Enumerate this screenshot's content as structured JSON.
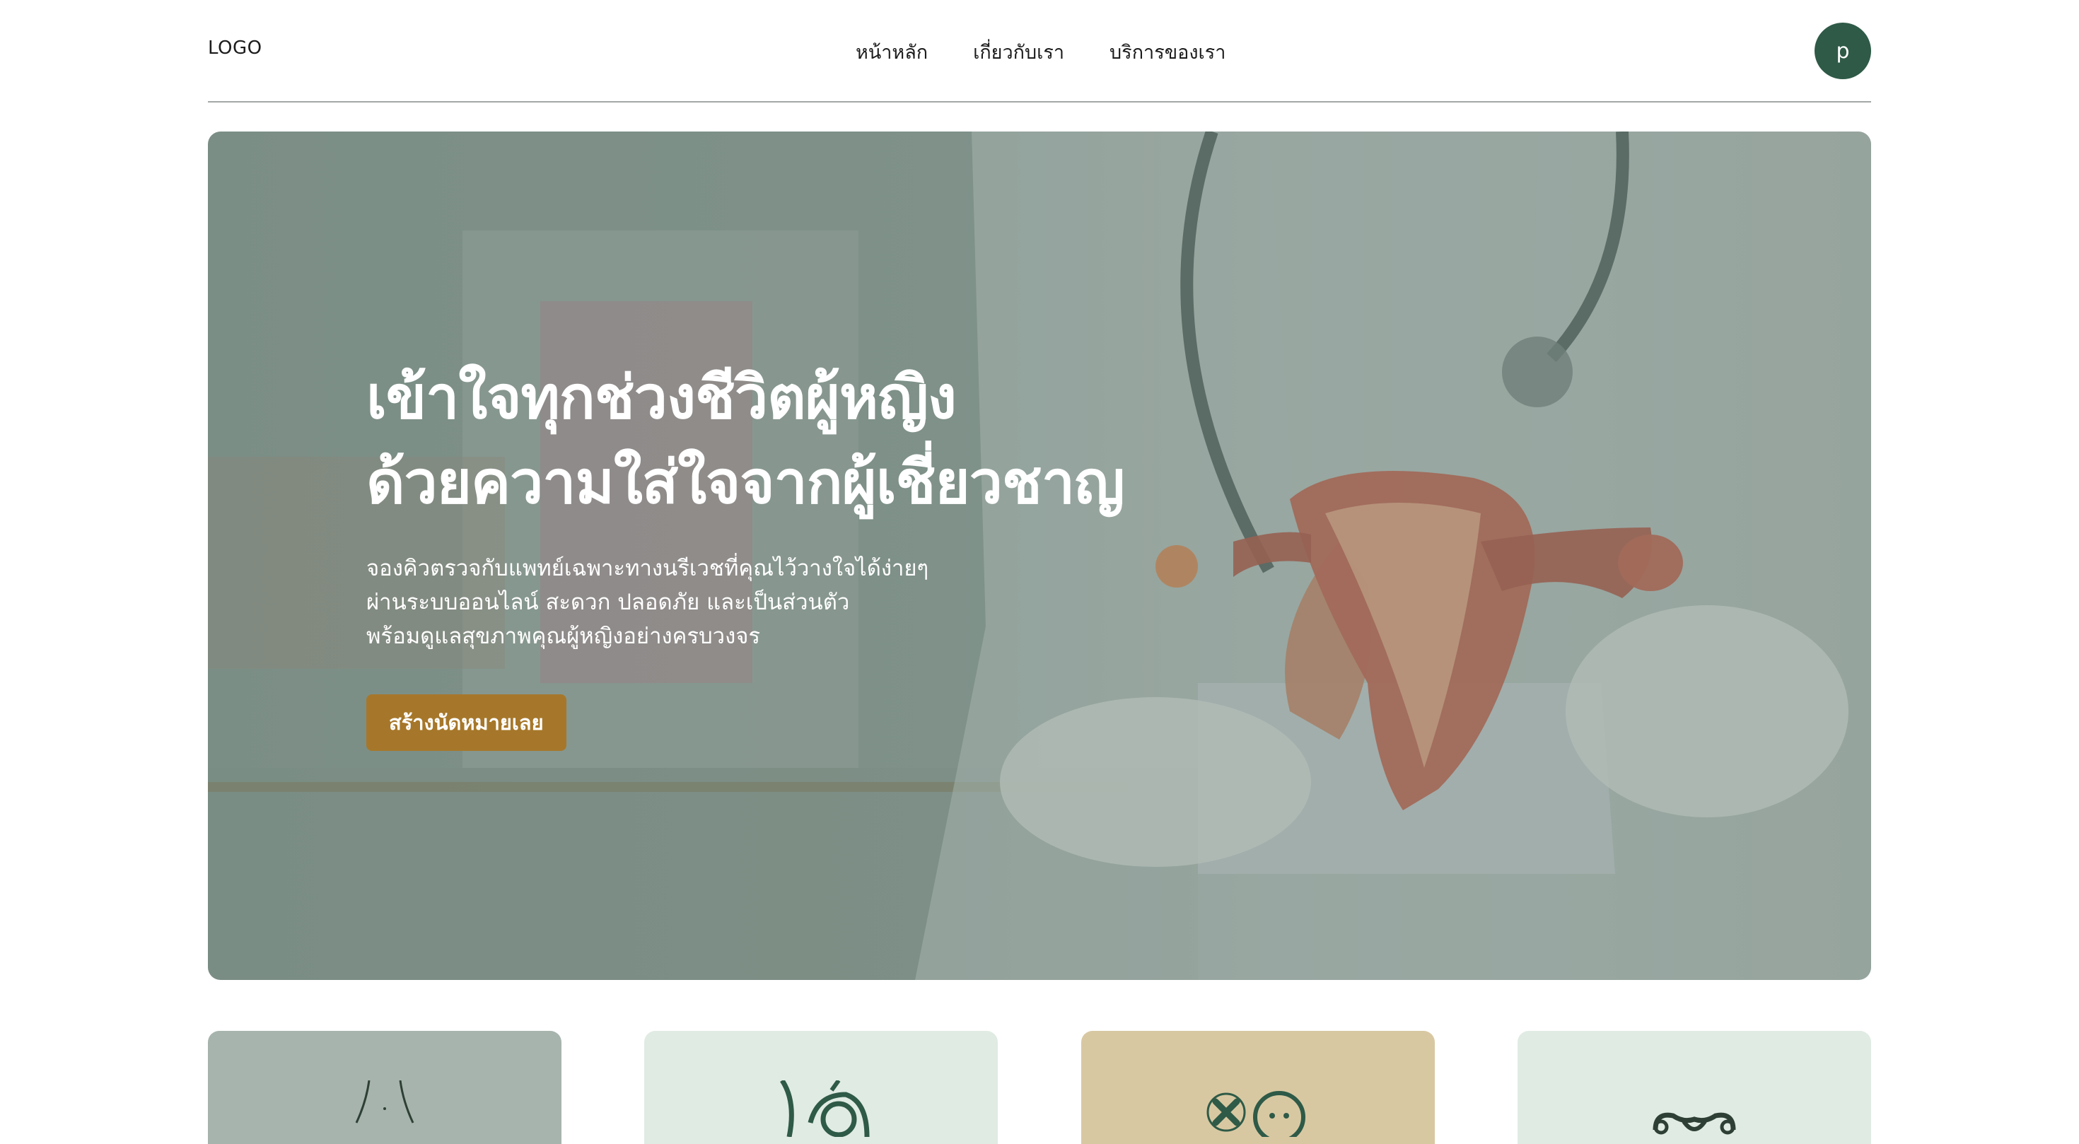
{
  "header": {
    "logo": "LOGO",
    "nav": [
      "หน้าหลัก",
      "เกี่ยวกับเรา",
      "บริการของเรา"
    ],
    "avatar_initial": "p"
  },
  "hero": {
    "title_lines": [
      "เข้าใจทุกช่วงชีวิตผู้หญิง",
      "ด้วยความใส่ใจจากผู้เชี่ยวชาญ"
    ],
    "description_lines": [
      "จองคิวตรวจกับแพทย์เฉพาะทางนรีเวชที่คุณไว้วางใจได้ง่ายๆ",
      "ผ่านระบบออนไลน์ สะดวก ปลอดภัย และเป็นส่วนตัว",
      "พร้อมดูแลสุขภาพคุณผู้หญิงอย่างครบวงจร"
    ],
    "cta_label": "สร้างนัดหมายเลย"
  },
  "cards": [
    {
      "icon": "body-silhouette-icon",
      "color": "#a7b4ad"
    },
    {
      "icon": "fetus-icon",
      "color": "#e0ebe3"
    },
    {
      "icon": "no-sick-icon",
      "color": "#d8c8a2"
    },
    {
      "icon": "uterus-icon",
      "color": "#e0ebe3"
    }
  ],
  "colors": {
    "brand_green": "#2e5a47",
    "cta_gold": "#a6772a"
  }
}
